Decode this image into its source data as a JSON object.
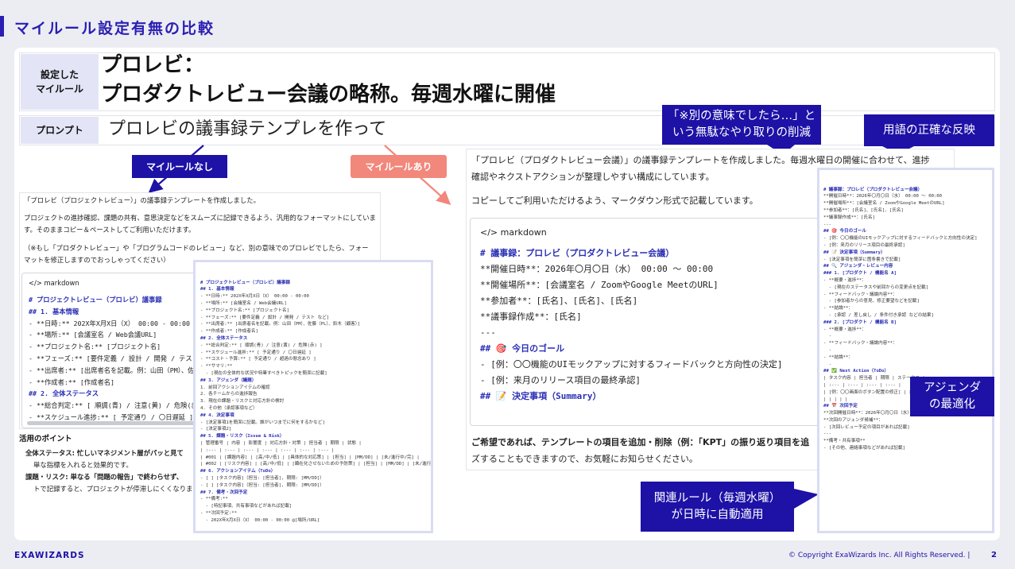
{
  "page_title": "マイルール設定有無の比較",
  "rule": {
    "label": "設定した\nマイルール",
    "line1": "プロレビ：",
    "line2": "プロダクトレビュー会議の略称。毎週水曜に開催"
  },
  "prompt": {
    "label": "プロンプト",
    "text": "プロレビの議事録テンプレを作って"
  },
  "tags": {
    "without": "マイルールなし",
    "with": "マイルールあり"
  },
  "callouts": {
    "reduction": "「※別の意味でしたら…」と\nいう無駄なやり取りの削減",
    "accurate": "用語の正確な反映",
    "agenda": "アジェンダ\nの最適化",
    "related": "関連ルール（毎週水曜）\nが日時に自動適用"
  },
  "left": {
    "lines": [
      "「プロレビ（プロジェクトレビュー）」の議事録テンプレートを作成しました。",
      "プロジェクトの進捗確認、課題の共有、意思決定などをスムーズに記録できるよう、汎用的なフォーマットにしていま",
      "す。そのままコピー＆ペーストしてご利用いただけます。",
      "（※もし「プロダクトレビュー」や「プログラムコードのレビュー」など、別の意味でのプロレビでしたら、フォー",
      "マットを修正しますのでおっしゃってください）"
    ],
    "code_lang": "</> markdown",
    "code": [
      "# プロジェクトレビュー（プロレビ）議事録",
      "",
      "## 1. 基本情報",
      "- **日時:** 202X年X月X日（X） 00:00 - 00:00",
      "- **場所:** [会議室名 / Web会議URL]",
      "- **プロジェクト名:** [プロジェクト名]",
      "- **フェーズ:** [要件定義 / 設計 / 開発 / テスト",
      "- **出席者:** [出席者名を記載。例：山田（PM）、佐",
      "- **作成者:** [作成者名]",
      "",
      "## 2. 全体ステータス",
      "- **総合判定:** [ 順調(青) / 注意(黄) / 危険(赤",
      "- **スケジュール進捗:** [ 予定通り / 〇日遅延 ]"
    ],
    "points_title": "活用のポイント",
    "points": [
      "全体ステータス: 忙しいマネジメント層がパッと見て",
      "単な指標を入れると効果的です。",
      "課題・リスク: 単なる「問題の報告」で終わらせず、",
      "トで記録すると、プロジェクトが停滞しにくくなりま"
    ],
    "overlay": [
      "# プロジェクトレビュー（プロレビ）議事録",
      "",
      "## 1. 基本情報",
      "- **日時:** 202X年X月X日（X） 00:00 - 00:00",
      "- **場所:** [会議室名 / Web会議URL]",
      "- **プロジェクト名:** [プロジェクト名]",
      "- **フェーズ:** [要件定義 / 設計 / 開発 / テスト など]",
      "- **出席者:** [出席者名を記載。例：山田（PM）、佐藤（PL）、鈴木（顧客）]",
      "- **作成者:** [作成者名]",
      "",
      "## 2. 全体ステータス",
      "- **総合判定:** [ 順調(青) / 注意(黄) / 危険(赤) ]",
      "- **スケジュール進捗:** [ 予定通り / 〇日遅延 ]",
      "- **コスト・予算:** [ 予定通り / 超過の懸念あり ]",
      "- **サマリ:**",
      "  - [現在の全体的な状況や特筆すべきトピックを簡潔に記載]",
      "",
      "## 3. アジェンダ（議題）",
      "1. 前回アクションアイテムの確認",
      "2. 各チームからの進捗報告",
      "3. 現在の課題・リスクと対応方針の検討",
      "4. その他（承認事項など）",
      "",
      "## 4. 決定事項",
      "- [決定事項1を簡潔に記載。誰がいつまでに何をするかなど]",
      "- [決定事項2]",
      "",
      "## 5. 課題・リスク（Issue & Risk）",
      "| 管理番号 | 内容 | 影響度 | 対応方針・対策 | 担当者 | 期限 | 状態 |",
      "| :--- | :--- | :--- | :--- | :--- | :--- | :--- |",
      "| #001 | [課題内容] | [高/中/低] | [具体的な対応策] | [担当] | [MM/DD] | [未/進行中/完] |",
      "| #002 | [リスク内容] | [高/中/低] | [顕在化させないための予防策] | [担当] | [MM/DD] | [未/進行中/完] |",
      "",
      "## 6. アクションアイテム（ToDo）",
      "- [ ] [タスク内容]（担当: [担当者], 期限: [MM/DD]）",
      "- [ ] [タスク内容]（担当: [担当者], 期限: [MM/DD]）",
      "",
      "## 7. 備考・次回予定",
      "- **備考:**",
      "  - [特記事項、共有事項などがあれば記載]",
      "- **次回予定:**",
      "  - 202X年X月X日（X） 00:00 - 00:00 @[場所/URL]"
    ]
  },
  "right": {
    "intro1": "「プロレビ（プロダクトレビュー会議）」の議事録テンプレートを作成しました。毎週水曜日の開催に合わせて、進捗",
    "intro2": "確認やネクストアクションが整理しやすい構成にしています。",
    "intro3": "コピーしてご利用いただけるよう、マークダウン形式で記載しています。",
    "code_lang": "</> markdown",
    "code": [
      "# 議事録：プロレビ（プロダクトレビュー会議）",
      "",
      "**開催日時**：2026年〇月〇日（水） 00:00 ～ 00:00",
      "**開催場所**：[会議室名 / ZoomやGoogle MeetのURL]",
      "**参加者**：[氏名]、[氏名]、[氏名]",
      "**議事録作成**：[氏名]",
      "",
      "---",
      "",
      "## 🎯 今日のゴール",
      "- [例：〇〇機能のUIモックアップに対するフィードバックと方向性の決定]",
      "- [例：来月のリリース項目の最終承認]",
      "",
      "## 📝 決定事項（Summary）"
    ],
    "closing1": "ご希望であれば、テンプレートの項目を追加・削除（例：「KPT」の振り返り項目を追",
    "closing2": "ズすることもできますので、お気軽にお知らせください。",
    "overlay": [
      "# 議事録：プロレビ（プロダクトレビュー会議）",
      "",
      "**開催日時**：2026年〇月〇日（水） 00:00 ～ 00:00",
      "**開催場所**：[会議室名 / ZoomやGoogle MeetのURL]",
      "**参加者**：[氏名]、[氏名]、[氏名]",
      "**議事録作成**：[氏名]",
      "",
      "---",
      "",
      "## 🎯 今日のゴール",
      "- [例：〇〇機能のUIモックアップに対するフィードバックと方向性の決定]",
      "- [例：来月のリリース項目の最終承認]",
      "",
      "## 📝 決定事項（Summary）",
      "- [決定事項を簡潔に箇条書きで記載]",
      "",
      "## 🔍 アジェンダ・レビュー内容",
      "",
      "### 1. [プロダクト / 機能名 A]",
      "- **概要・進捗**：",
      "  - [現在のステータスや前回からの変更点を記載]",
      "- **フィードバック・議論内容**：",
      "  - [参加者からの意見、修正要望などを記載]",
      "- **結論**：",
      "  - [承認 / 差し戻し / 条件付き承認 などの結果]",
      "",
      "### 2. [プロダクト / 機能名 B]",
      "- **概要・進捗**：",
      "  -",
      "- **フィードバック・議論内容**：",
      "  -",
      "- **結論**：",
      "  -",
      "",
      "## ✅ Next Action（ToDo）",
      "| タスク内容 | 担当者 | 期限 | ステータス |",
      "| :--- | :--- | :--- | :--- |",
      "| [例：〇〇画面のボタン配置の修正] | [氏名] | 〇/〇(水) | 未着手 |",
      "| | | | |",
      "",
      "## 📅 次回予定",
      "**次回開催日時**：2026年〇月〇日（水） 00:00 ～ 00:00",
      "**次回のアジェンダ候補**：",
      "- [次回レビュー予定の項目があれば記載]",
      "",
      "---",
      "**備考・共有事項**",
      "- [その他、連絡事項などがあれば記載]"
    ]
  },
  "footer": {
    "logo": "EXAWIZARDS",
    "copyright": "© Copyright ExaWizards Inc. All Rights Reserved.  |",
    "page": "2"
  },
  "colors": {
    "primary": "#1d11a6",
    "accent": "#f2877b",
    "label_bg": "#e3e4f6"
  }
}
